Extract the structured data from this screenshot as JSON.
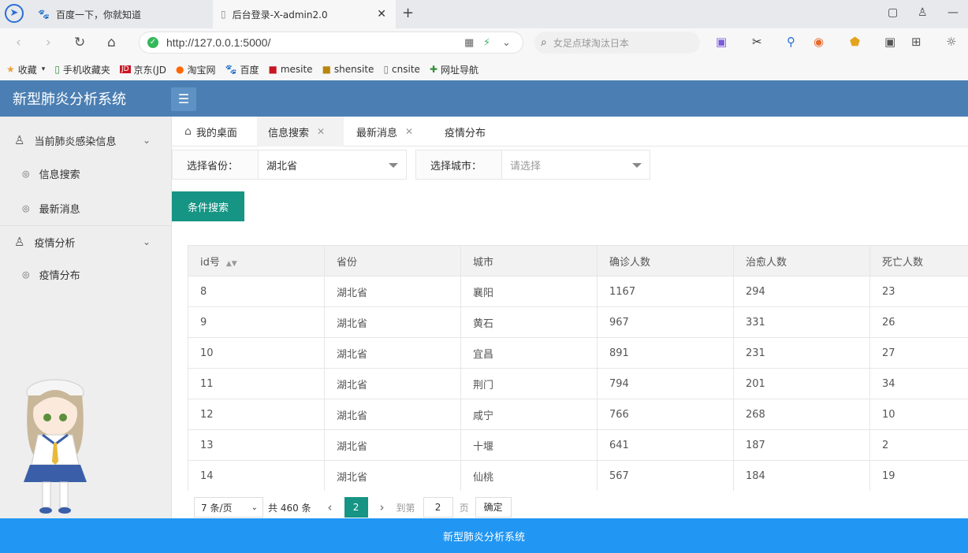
{
  "browser": {
    "tabs": [
      {
        "title": "百度一下，你就知道",
        "active": false
      },
      {
        "title": "后台登录-X-admin2.0",
        "active": true
      }
    ],
    "address": "http://127.0.0.1:5000/",
    "search_placeholder": "女足点球淘汰日本",
    "bookmarks": [
      "收藏",
      "手机收藏夹",
      "京东(JD",
      "淘宝网",
      "百度",
      "mesite",
      "shensite",
      "cnsite",
      "网址导航"
    ]
  },
  "app": {
    "title": "新型肺炎分析系统",
    "footer": "新型肺炎分析系统"
  },
  "sidebar": {
    "groups": [
      {
        "label": "当前肺炎感染信息",
        "items": [
          "信息搜索",
          "最新消息"
        ]
      },
      {
        "label": "疫情分析",
        "items": [
          "疫情分布"
        ]
      }
    ]
  },
  "page_tabs": [
    {
      "label": "我的桌面",
      "closable": false,
      "active": false
    },
    {
      "label": "信息搜索",
      "closable": true,
      "active": true
    },
    {
      "label": "最新消息",
      "closable": true,
      "active": false
    },
    {
      "label": "疫情分布",
      "closable": false,
      "active": false
    }
  ],
  "filters": {
    "province_label": "选择省份：",
    "province_value": "湖北省",
    "city_label": "选择城市：",
    "city_placeholder": "请选择"
  },
  "search_button": "条件搜索",
  "table": {
    "headers": [
      "id号",
      "省份",
      "城市",
      "确诊人数",
      "治愈人数",
      "死亡人数"
    ],
    "rows": [
      [
        "8",
        "湖北省",
        "襄阳",
        "1167",
        "294",
        "23"
      ],
      [
        "9",
        "湖北省",
        "黄石",
        "967",
        "331",
        "26"
      ],
      [
        "10",
        "湖北省",
        "宜昌",
        "891",
        "231",
        "27"
      ],
      [
        "11",
        "湖北省",
        "荆门",
        "794",
        "201",
        "34"
      ],
      [
        "12",
        "湖北省",
        "咸宁",
        "766",
        "268",
        "10"
      ],
      [
        "13",
        "湖北省",
        "十堰",
        "641",
        "187",
        "2"
      ],
      [
        "14",
        "湖北省",
        "仙桃",
        "567",
        "184",
        "19"
      ]
    ]
  },
  "pagination": {
    "page_size": "7 条/页",
    "total": "共 460 条",
    "current": "2",
    "goto_label": "到第",
    "goto_value": "2",
    "page_unit": "页",
    "confirm": "确定"
  }
}
